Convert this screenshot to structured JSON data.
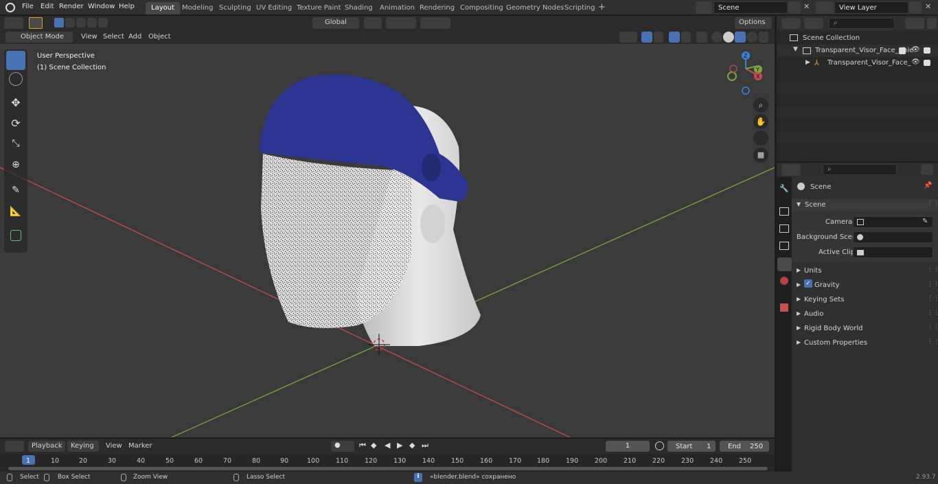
{
  "menu": [
    "File",
    "Edit",
    "Render",
    "Window",
    "Help"
  ],
  "workspaces": [
    "Layout",
    "Modeling",
    "Sculpting",
    "UV Editing",
    "Texture Paint",
    "Shading",
    "Animation",
    "Rendering",
    "Compositing",
    "Geometry Nodes",
    "Scripting"
  ],
  "scene_field": "Scene",
  "view_layer_field": "View Layer",
  "tool_header": {
    "orientation": "Global",
    "options": "Options"
  },
  "viewport_header": {
    "mode": "Object Mode",
    "menus": [
      "View",
      "Select",
      "Add",
      "Object"
    ]
  },
  "viewport": {
    "overlay_title": "User Perspective",
    "overlay_sub": "(1) Scene Collection"
  },
  "outliner": {
    "search_placeholder": "",
    "root": "Scene Collection",
    "items": [
      {
        "label": "Transparent_Visor_Face_Shie"
      },
      {
        "label": "Transparent_Visor_Face_"
      }
    ]
  },
  "properties": {
    "header": "Scene",
    "panel": "Scene",
    "camera_label": "Camera",
    "bg_scene_label": "Background Scene",
    "active_clip_label": "Active Clip",
    "sections": [
      "Units",
      "Gravity",
      "Keying Sets",
      "Audio",
      "Rigid Body World",
      "Custom Properties"
    ],
    "gravity_checked": true
  },
  "timeline": {
    "menus": [
      "Playback",
      "Keying",
      "View",
      "Marker"
    ],
    "current_frame": "1",
    "start_label": "Start",
    "start": "1",
    "end_label": "End",
    "end": "250",
    "ticks": [
      "1",
      "10",
      "20",
      "30",
      "40",
      "50",
      "60",
      "70",
      "80",
      "90",
      "100",
      "110",
      "120",
      "130",
      "140",
      "150",
      "160",
      "170",
      "180",
      "190",
      "200",
      "210",
      "220",
      "230",
      "240",
      "250"
    ]
  },
  "statusbar": {
    "select": "Select",
    "box_select": "Box Select",
    "zoom_view": "Zoom View",
    "lasso_select": "Lasso Select",
    "message": "«blender.blend» сохранено",
    "version": "2.93.7"
  },
  "colors": {
    "accent": "#4772b3",
    "x_axis": "#c84b4b",
    "y_axis": "#7aa63c",
    "z_axis": "#3b82d6",
    "helmet": "#2d3592"
  },
  "gizmo_labels": {
    "z": "Z",
    "y": "Y",
    "x": "X"
  }
}
